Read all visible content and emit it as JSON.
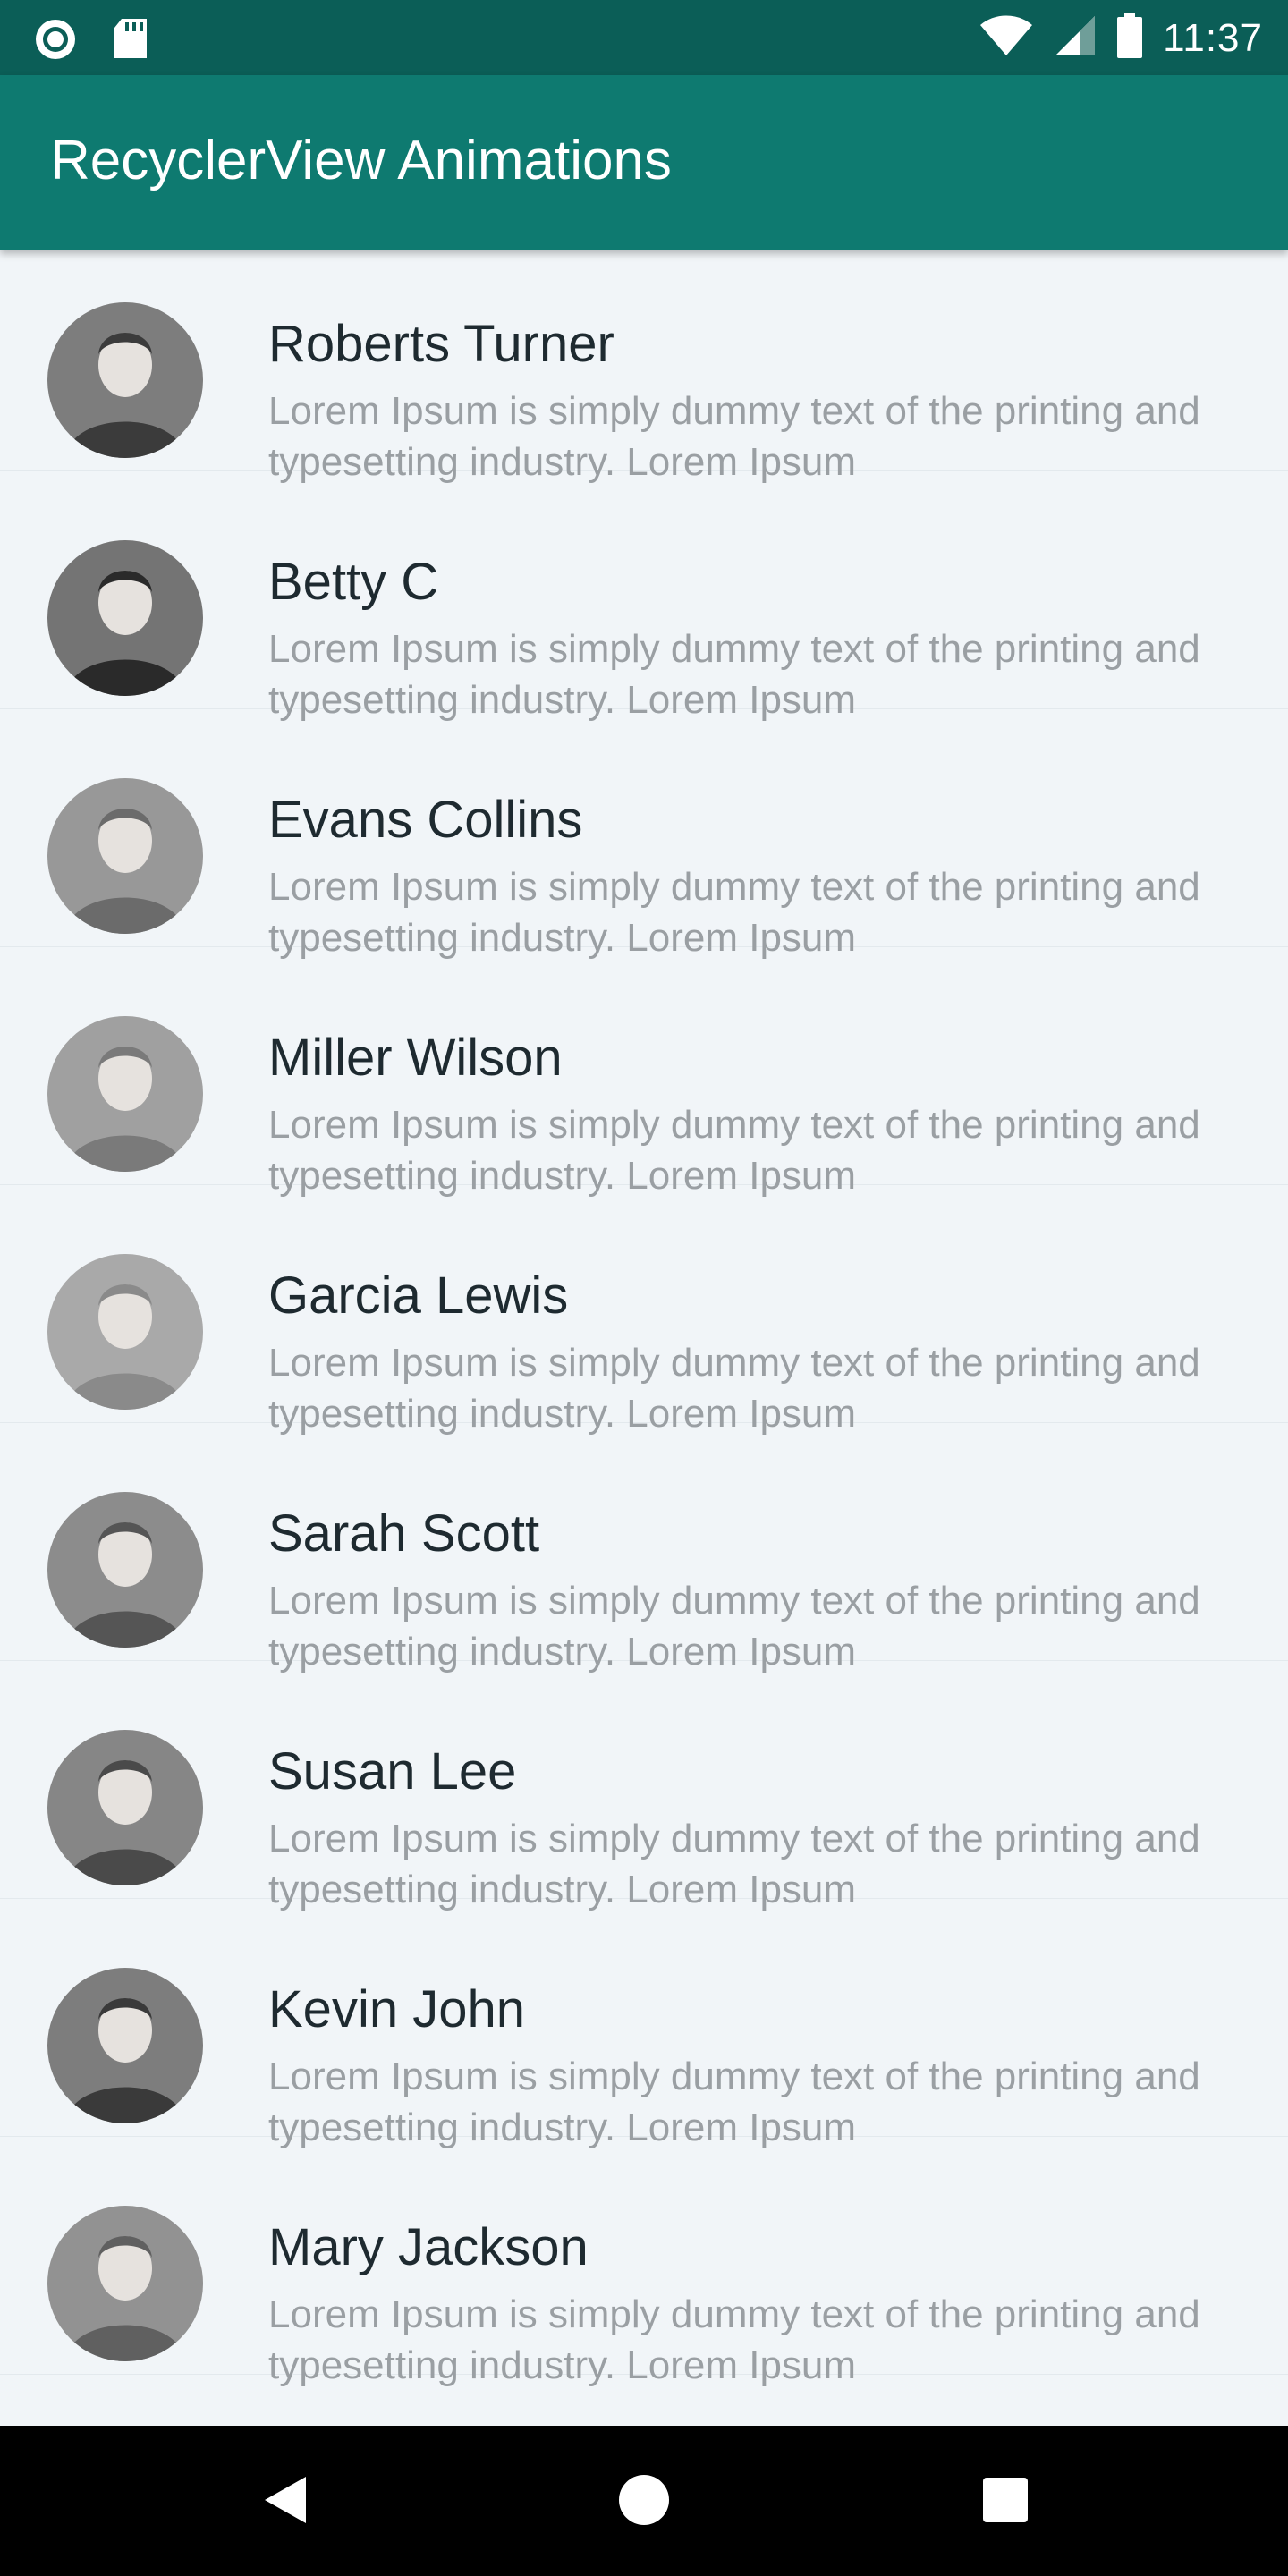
{
  "status_bar": {
    "time": "11:37",
    "icons": [
      "app-notification-icon",
      "sd-card-icon",
      "wifi-icon",
      "signal-icon",
      "battery-icon"
    ]
  },
  "app_bar": {
    "title": "RecyclerView Animations",
    "color": "#0e7a70"
  },
  "list": {
    "items": [
      {
        "name": "",
        "description": "Lorem Ipsum is simply dummy text of the printing and typesetting industry. Lorem Ipsum",
        "avatar_tone": "#5a5a5a"
      },
      {
        "name": "Roberts Turner",
        "description": "Lorem Ipsum is simply dummy text of the printing and typesetting industry. Lorem Ipsum",
        "avatar_tone": "#3b3b3b"
      },
      {
        "name": "Betty C",
        "description": "Lorem Ipsum is simply dummy text of the printing and typesetting industry. Lorem Ipsum",
        "avatar_tone": "#2a2a2a"
      },
      {
        "name": "Evans Collins",
        "description": "Lorem Ipsum is simply dummy text of the printing and typesetting industry. Lorem Ipsum",
        "avatar_tone": "#6b6b6b"
      },
      {
        "name": "Miller Wilson",
        "description": "Lorem Ipsum is simply dummy text of the printing and typesetting industry. Lorem Ipsum",
        "avatar_tone": "#7a7a7a"
      },
      {
        "name": "Garcia Lewis",
        "description": "Lorem Ipsum is simply dummy text of the printing and typesetting industry. Lorem Ipsum",
        "avatar_tone": "#8a8a8a"
      },
      {
        "name": "Sarah Scott",
        "description": "Lorem Ipsum is simply dummy text of the printing and typesetting industry. Lorem Ipsum",
        "avatar_tone": "#555555"
      },
      {
        "name": "Susan Lee",
        "description": "Lorem Ipsum is simply dummy text of the printing and typesetting industry. Lorem Ipsum",
        "avatar_tone": "#4a4a4a"
      },
      {
        "name": "Kevin John",
        "description": "Lorem Ipsum is simply dummy text of the printing and typesetting industry. Lorem Ipsum",
        "avatar_tone": "#3a3a3a"
      },
      {
        "name": "Mary Jackson",
        "description": "Lorem Ipsum is simply dummy text of the printing and typesetting industry. Lorem Ipsum",
        "avatar_tone": "#606060"
      }
    ]
  },
  "nav_bar": {
    "buttons": [
      "back-icon",
      "home-icon",
      "recents-icon"
    ]
  }
}
